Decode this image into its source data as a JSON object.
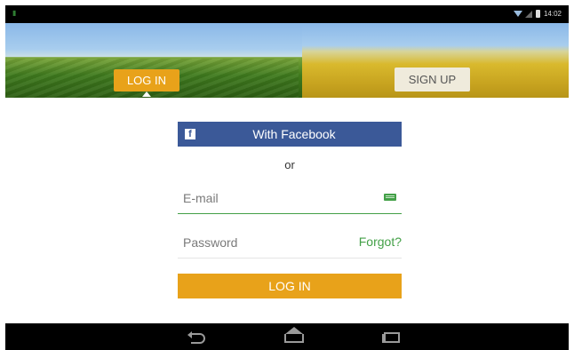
{
  "status_bar": {
    "time": "14:02",
    "icons": [
      "app-icon",
      "wifi-icon",
      "signal-icon",
      "battery-icon"
    ]
  },
  "tabs": {
    "login_label": "LOG IN",
    "signup_label": "SIGN UP"
  },
  "facebook_button": {
    "label": "With Facebook",
    "icon": "facebook-icon"
  },
  "separator_text": "or",
  "email_field": {
    "placeholder": "E-mail",
    "value": "",
    "icon": "keyboard-icon"
  },
  "password_field": {
    "placeholder": "Password",
    "value": "",
    "forgot_label": "Forgot?"
  },
  "login_button_label": "LOG IN",
  "nav_bar": {
    "icons": [
      "back-icon",
      "home-icon",
      "recents-icon"
    ]
  },
  "colors": {
    "accent": "#e8a21a",
    "facebook": "#3b5998",
    "link_green": "#43a047",
    "status_bar_bg": "#000000"
  }
}
